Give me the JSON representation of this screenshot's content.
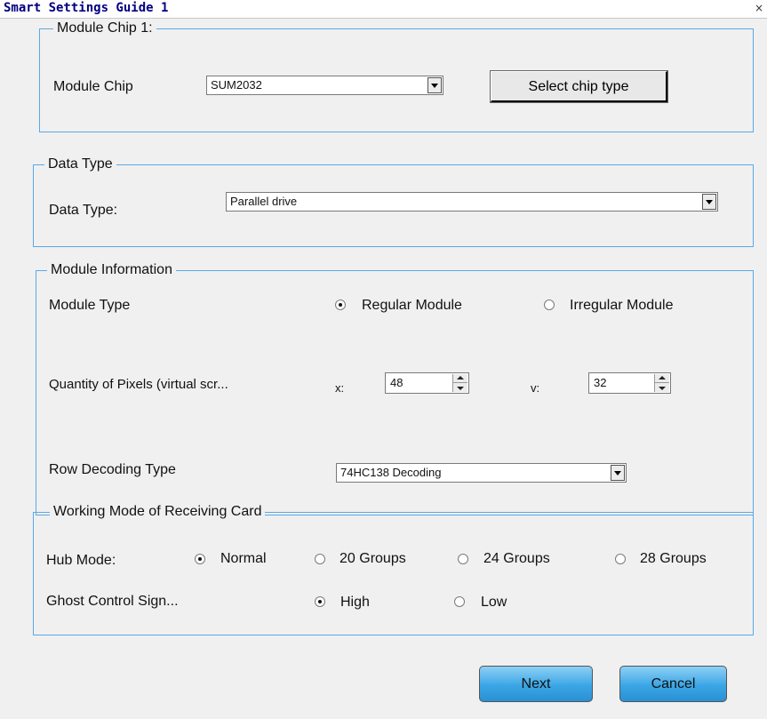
{
  "window": {
    "title": "Smart Settings Guide 1",
    "close_glyph": "×"
  },
  "module_chip": {
    "legend": "Module Chip 1:",
    "label": "Module Chip",
    "value": "SUM2032",
    "select_button": "Select chip type"
  },
  "data_type": {
    "legend": "Data Type",
    "label": "Data Type:",
    "value": "Parallel drive"
  },
  "module_info": {
    "legend": "Module Information",
    "module_type_label": "Module Type",
    "regular": "Regular Module",
    "irregular": "Irregular Module",
    "selected_module_type": "Regular Module",
    "pixels_label": "Quantity of Pixels (virtual scr...",
    "x_label": "x:",
    "x_value": "48",
    "y_label": "v:",
    "y_value": "32",
    "row_decoding_label": "Row Decoding Type",
    "row_decoding_value": "74HC138 Decoding"
  },
  "working_mode": {
    "legend": "Working Mode of Receiving Card",
    "hub_label": "Hub Mode:",
    "hub_options": [
      "Normal",
      "20 Groups",
      "24 Groups",
      "28 Groups"
    ],
    "hub_selected": "Normal",
    "ghost_label": "Ghost Control Sign...",
    "ghost_options": [
      "High",
      "Low"
    ],
    "ghost_selected": "High"
  },
  "footer": {
    "next": "Next",
    "cancel": "Cancel"
  }
}
